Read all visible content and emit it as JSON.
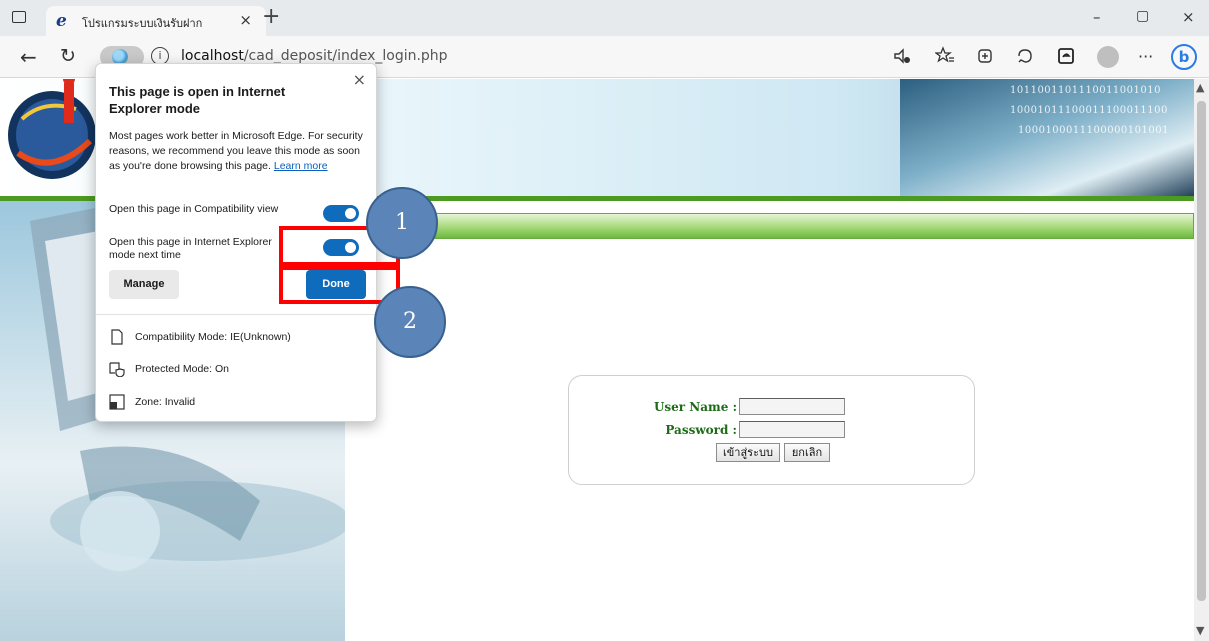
{
  "browser": {
    "tab": {
      "title": "โปรแกรมระบบเงินรับฝาก",
      "close": "×",
      "ie_glyph": "e"
    },
    "new_tab": "+",
    "window_controls": {
      "minimize": "–",
      "maximize": "▢",
      "close": "×"
    },
    "nav": {
      "back": "←",
      "reload": "↻",
      "info": "i"
    },
    "url": {
      "host": "localhost",
      "path": "/cad_deposit/index_login.php"
    },
    "toolbar_icons": [
      "read-aloud-icon",
      "favorites-icon",
      "collections-icon",
      "extensions-icon",
      "edge-bar-icon",
      "profile-icon",
      "more-icon",
      "bing-icon"
    ],
    "more": "···",
    "bing": "b"
  },
  "flyout": {
    "close": "×",
    "title": "This page is open in Internet Explorer mode",
    "description": "Most pages work better in Microsoft Edge. For security reasons, we recommend you leave this mode as soon as you're done browsing this page.",
    "learn_more": "Learn more",
    "compat_view_label": "Open this page in Compatibility view",
    "compat_view_on": true,
    "ie_mode_next_label": "Open this page in Internet Explorer mode next time",
    "ie_mode_next_on": true,
    "manage_label": "Manage",
    "done_label": "Done",
    "info": {
      "compatibility_mode": "Compatibility Mode: IE(Unknown)",
      "protected_mode": "Protected Mode: On",
      "zone": "Zone: Invalid"
    }
  },
  "login": {
    "username_label": "User Name :",
    "password_label": "Password :",
    "username_value": "",
    "password_value": "",
    "login_button": "เข้าสู่ระบบ",
    "cancel_button": "ยกเลิก"
  },
  "banner": {
    "binary_lines": [
      "1011001101110011001010",
      "10001011100011100011100",
      "1000100011100000101001"
    ]
  },
  "annotations": {
    "step1": "1",
    "step2": "2"
  },
  "colors": {
    "accent": "#0f6cbd",
    "annotation_red": "#ff0000",
    "annotation_circle": "#5b84b8",
    "label_green": "#1b6b17",
    "green_line": "#4c9a21"
  }
}
